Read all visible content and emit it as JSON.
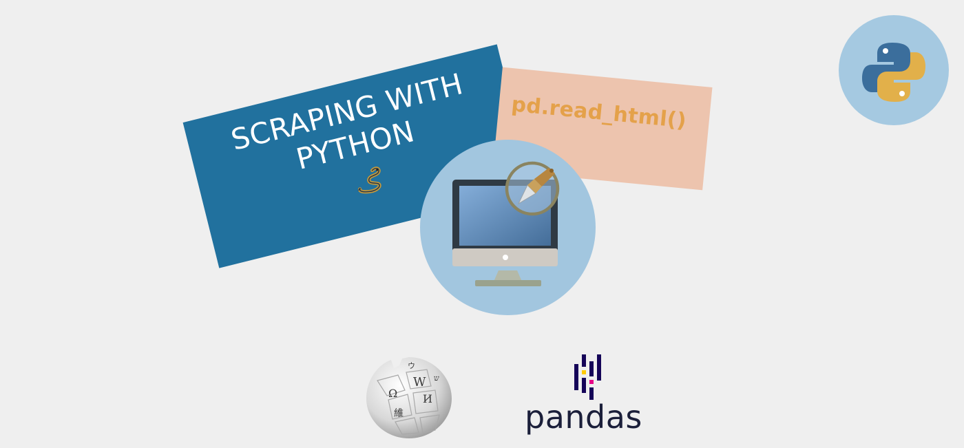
{
  "banner": {
    "line1": "SCRAPING WITH",
    "line2": "PYTHON",
    "color": "#21719e"
  },
  "code_card": {
    "text": "pd.read_html()",
    "background": "#edc4ae",
    "text_color": "#e4a14a"
  },
  "monitor": {
    "icon": "computer-with-scraper-icon",
    "circle_color": "#a2c6df"
  },
  "python_logo": {
    "icon": "python-logo-icon",
    "circle_color": "#a5c9e1"
  },
  "wikipedia": {
    "icon": "wikipedia-globe-icon"
  },
  "pandas": {
    "wordmark": "pandas",
    "icon": "pandas-logo-icon",
    "color": "#150458"
  },
  "background_color": "#efefef"
}
